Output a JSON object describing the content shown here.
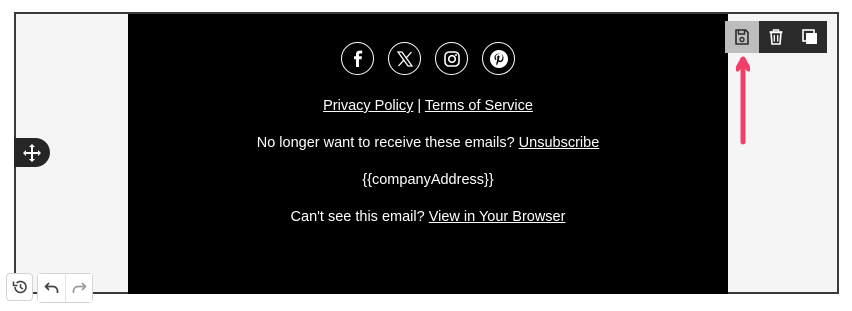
{
  "footer": {
    "social_icons": [
      "facebook-icon",
      "x-icon",
      "instagram-icon",
      "pinterest-icon"
    ],
    "privacy_label": "Privacy Policy",
    "separator": " | ",
    "terms_label": "Terms of Service",
    "unsubscribe_text": "No longer want to receive these emails? ",
    "unsubscribe_label": "Unsubscribe",
    "company_address": "{{companyAddress}}",
    "browser_text": "Can't see this email? ",
    "browser_label": "View in Your Browser"
  },
  "toolbar": {
    "icons": [
      "save-icon",
      "trash-icon",
      "duplicate-icon"
    ]
  },
  "history": {
    "icons": [
      "history-icon",
      "undo-icon",
      "redo-icon"
    ]
  },
  "colors": {
    "email_background": "#000000",
    "canvas_background": "#f5f5f5",
    "arrow": "#f0406a",
    "toolbar_active": "#bdbdbd",
    "toolbar_dark": "#2b2b2b"
  }
}
